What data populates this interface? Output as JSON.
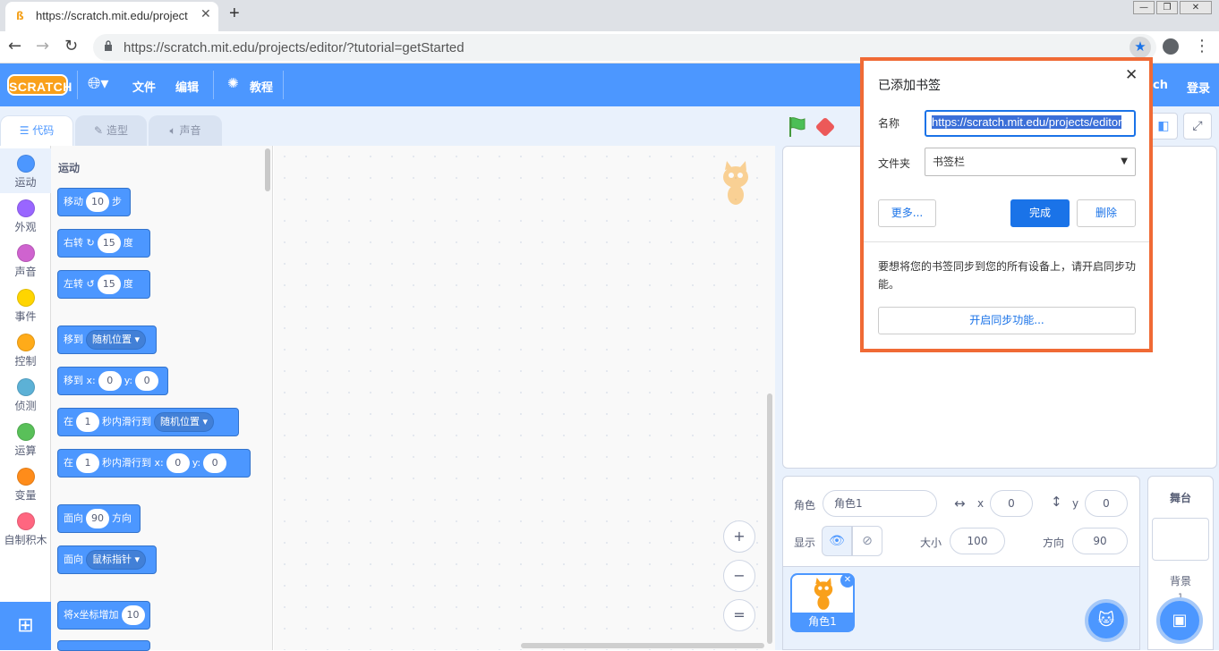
{
  "browser": {
    "tab_title": "https://scratch.mit.edu/project",
    "tab_close": "✕",
    "new_tab": "+",
    "url": "https://scratch.mit.edu/projects/editor/?tutorial=getStarted",
    "window_controls": [
      "—",
      "❐",
      "✕"
    ]
  },
  "menubar": {
    "logo": "SCRATCH",
    "file": "文件",
    "edit": "编辑",
    "tutorials": "教程",
    "right_partial": "ch",
    "login": "登录"
  },
  "editor_tabs": [
    {
      "label": "代码",
      "icon": "code-icon",
      "active": true
    },
    {
      "label": "造型",
      "icon": "brush-icon",
      "active": false
    },
    {
      "label": "声音",
      "icon": "speaker-icon",
      "active": false
    }
  ],
  "categories": [
    {
      "label": "运动",
      "color": "#4c97ff"
    },
    {
      "label": "外观",
      "color": "#9966ff"
    },
    {
      "label": "声音",
      "color": "#cf63cf"
    },
    {
      "label": "事件",
      "color": "#ffd500"
    },
    {
      "label": "控制",
      "color": "#ffab19"
    },
    {
      "label": "侦测",
      "color": "#5cb1d6"
    },
    {
      "label": "运算",
      "color": "#59c059"
    },
    {
      "label": "变量",
      "color": "#ff8c1a"
    },
    {
      "label": "自制积木",
      "color": "#ff6680"
    }
  ],
  "palette": {
    "heading": "运动",
    "blocks": {
      "move": {
        "pre": "移动",
        "val": "10",
        "post": "步"
      },
      "turn_right": {
        "pre": "右转",
        "icon": "↻",
        "val": "15",
        "post": "度"
      },
      "turn_left": {
        "pre": "左转",
        "icon": "↺",
        "val": "15",
        "post": "度"
      },
      "goto": {
        "pre": "移到",
        "drop": "随机位置 ▾"
      },
      "goto_xy": {
        "pre": "移到 x:",
        "x": "0",
        "mid": "y:",
        "y": "0"
      },
      "glide": {
        "pre": "在",
        "val": "1",
        "mid": "秒内滑行到",
        "drop": "随机位置 ▾"
      },
      "glide_xy": {
        "pre": "在",
        "val": "1",
        "mid": "秒内滑行到 x:",
        "x": "0",
        "mid2": "y:",
        "y": "0"
      },
      "point_dir": {
        "pre": "面向",
        "val": "90",
        "post": "方向"
      },
      "point_to": {
        "pre": "面向",
        "drop": "鼠标指针 ▾"
      },
      "change_x": {
        "pre": "将x坐标增加",
        "val": "10"
      }
    }
  },
  "zoom": {
    "in": "+",
    "out": "−",
    "reset": "="
  },
  "sprite_info": {
    "sprite_label": "角色",
    "sprite_name": "角色1",
    "x_label": "x",
    "x_value": "0",
    "y_label": "y",
    "y_value": "0",
    "show_label": "显示",
    "size_label": "大小",
    "size_value": "100",
    "direction_label": "方向",
    "direction_value": "90"
  },
  "sprite_list": {
    "thumb_name": "角色1"
  },
  "stage_panel": {
    "title": "舞台",
    "backdrops_label": "背景",
    "backdrop_count": "1"
  },
  "bookmark": {
    "title": "已添加书签",
    "name_label": "名称",
    "name_value": "https://scratch.mit.edu/projects/editor",
    "folder_label": "文件夹",
    "folder_value": "书签栏",
    "more": "更多...",
    "done": "完成",
    "delete": "删除",
    "sync_text": "要想将您的书签同步到您的所有设备上，请开启同步功能。",
    "sync_button": "开启同步功能...",
    "close": "✕"
  },
  "colors": {
    "scratch_blue": "#4c97ff",
    "highlight": "#f06a35",
    "chrome_blue": "#1a73e8"
  }
}
